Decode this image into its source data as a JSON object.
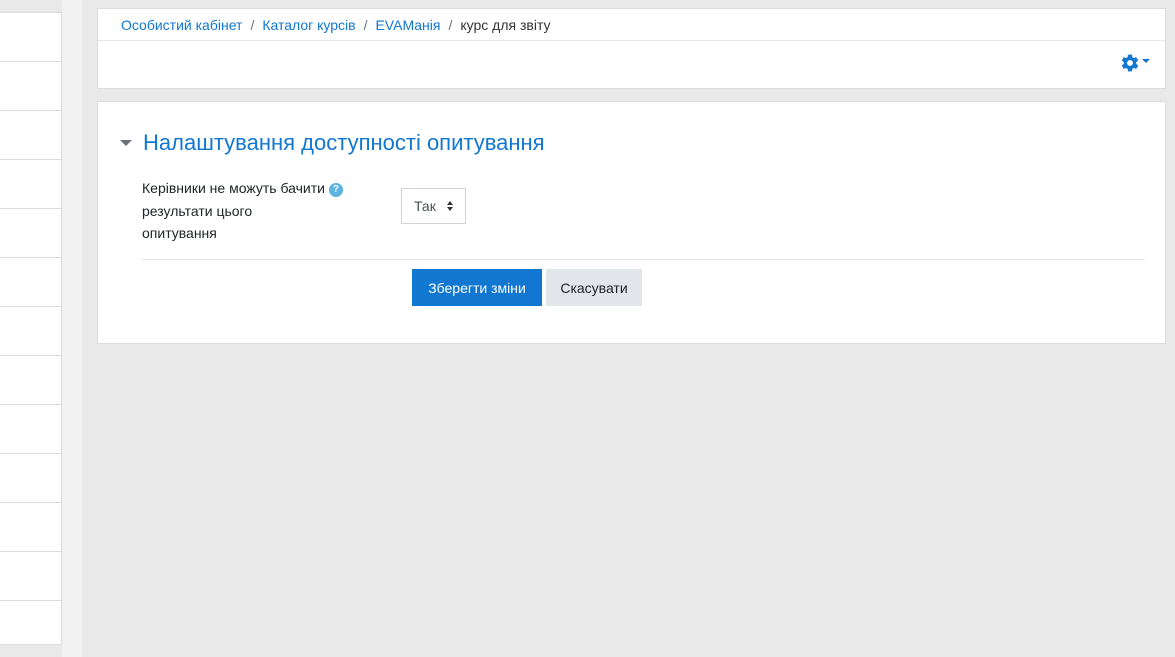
{
  "breadcrumb": {
    "items": [
      "Особистий кабінет",
      "Каталог курсів",
      "EVAМанія"
    ],
    "separator": "/",
    "current": "курс для звіту"
  },
  "header": {
    "settings_icon": "gear-icon"
  },
  "form": {
    "section_title": "Налаштування доступності опитування",
    "field_label_line1": "Керівники не можуть бачити",
    "field_label_line2": "результати цього",
    "field_label_line3": "опитування",
    "help_icon": "?",
    "select_value": "Так",
    "save_label": "Зберегти зміни",
    "cancel_label": "Скасувати"
  },
  "colors": {
    "accent": "#1177d1",
    "background": "#e9e9e9",
    "help": "#5bb5e0"
  }
}
